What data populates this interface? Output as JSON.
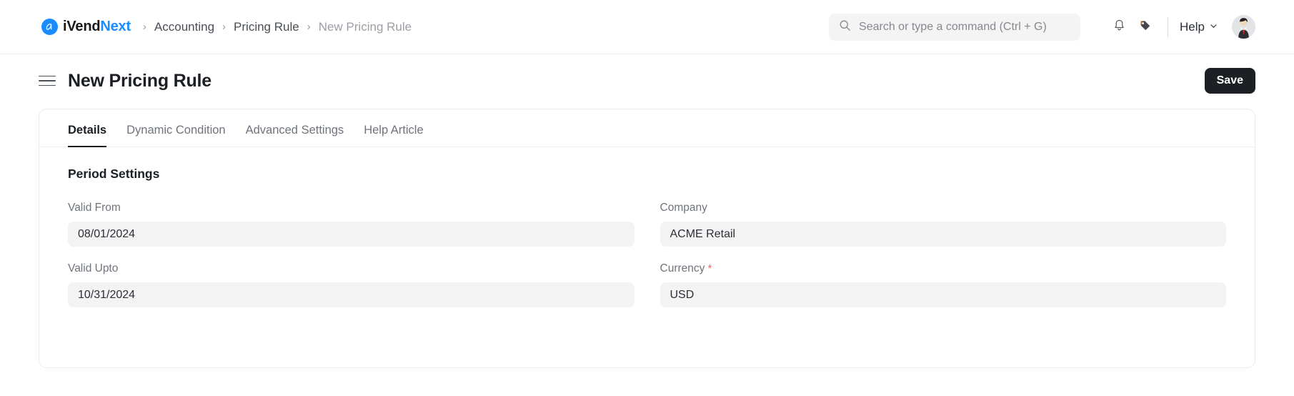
{
  "brand": {
    "name_dark": "iVend",
    "name_blue": "Next",
    "logo_icon": "ivendnext-logo-icon"
  },
  "breadcrumb": {
    "separator": "›",
    "items": [
      {
        "label": "Accounting",
        "current": false
      },
      {
        "label": "Pricing Rule",
        "current": false
      },
      {
        "label": "New Pricing Rule",
        "current": true
      }
    ]
  },
  "search": {
    "placeholder": "Search or type a command (Ctrl + G)",
    "value": "",
    "icon": "search-icon"
  },
  "header_actions": {
    "notifications_icon": "bell-icon",
    "tags_icon": "tag-icon",
    "help_label": "Help",
    "help_chevron_icon": "chevron-down-icon",
    "avatar_icon": "user-avatar"
  },
  "titlebar": {
    "menu_icon": "hamburger-menu-icon",
    "title": "New Pricing Rule",
    "save_label": "Save"
  },
  "tabs": [
    {
      "label": "Details",
      "active": true
    },
    {
      "label": "Dynamic Condition",
      "active": false
    },
    {
      "label": "Advanced Settings",
      "active": false
    },
    {
      "label": "Help Article",
      "active": false
    }
  ],
  "form": {
    "section_title": "Period Settings",
    "fields": [
      {
        "label": "Valid From",
        "value": "08/01/2024",
        "required": false
      },
      {
        "label": "Company",
        "value": "ACME Retail",
        "required": false
      },
      {
        "label": "Valid Upto",
        "value": "10/31/2024",
        "required": false
      },
      {
        "label": "Currency",
        "value": "USD",
        "required": true
      }
    ]
  },
  "colors": {
    "brand_blue": "#1a8cff",
    "required_red": "#ee6a61",
    "save_button_bg": "#1c1f23",
    "input_bg": "#f3f3f4"
  }
}
